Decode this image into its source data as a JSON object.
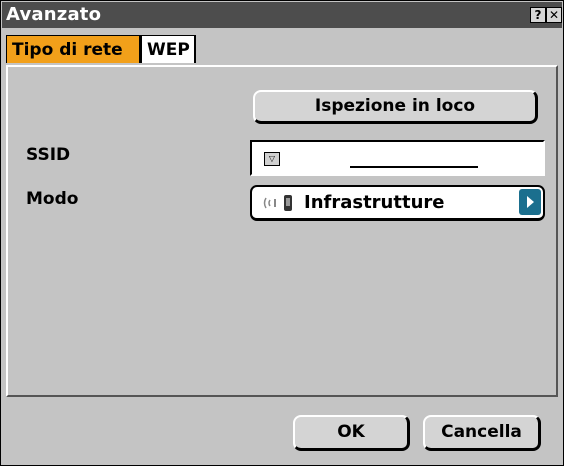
{
  "window": {
    "title": "Avanzato",
    "help_icon": "?",
    "close_icon": "✕"
  },
  "tabs": [
    {
      "label": "Tipo di rete",
      "active": true
    },
    {
      "label": "WEP",
      "active": false
    }
  ],
  "panel": {
    "survey_button": "Ispezione in loco",
    "ssid": {
      "label": "SSID",
      "value": "",
      "dropdown_icon": "triangle-down-icon"
    },
    "mode": {
      "label": "Modo",
      "value": "Infrastrutture",
      "icon": "wireless-device-icon",
      "next_icon": "chevron-right-icon"
    }
  },
  "footer": {
    "ok_label": "OK",
    "cancel_label": "Cancella"
  },
  "colors": {
    "titlebar": "#4d4d4d",
    "active_tab": "#f2a01a",
    "panel_bg": "#c4c4c4",
    "next_button": "#1b6f8e"
  }
}
